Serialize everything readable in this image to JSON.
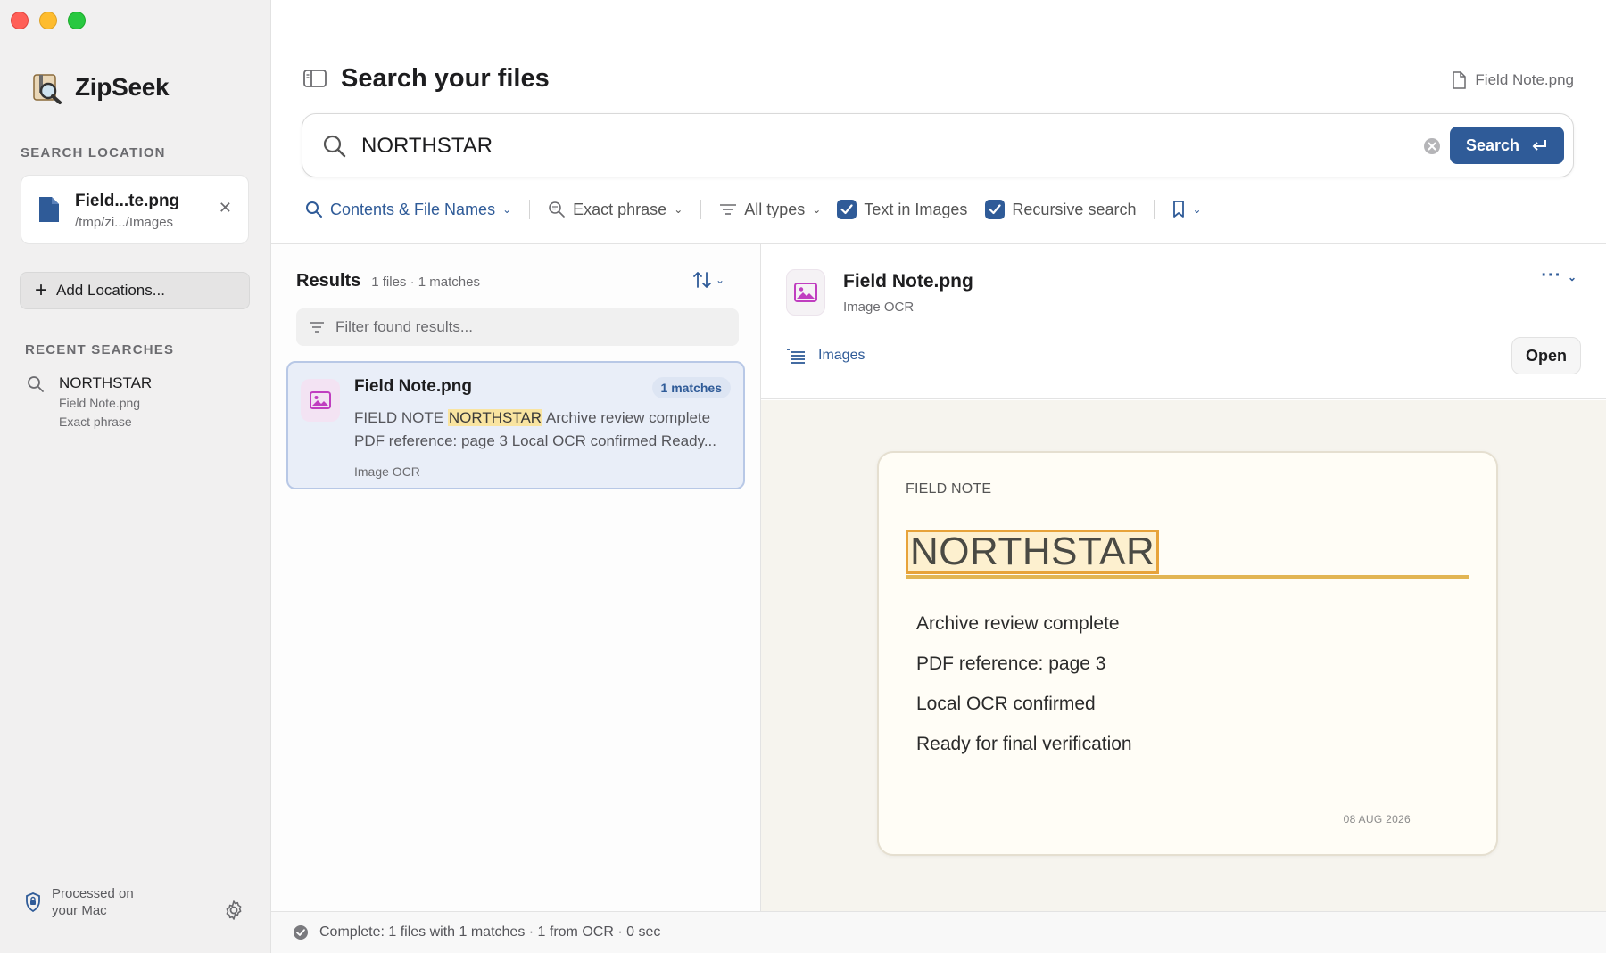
{
  "app": {
    "name": "ZipSeek"
  },
  "sidebar": {
    "search_location_label": "SEARCH LOCATION",
    "location": {
      "name": "Field...te.png",
      "path": "/tmp/zi.../Images"
    },
    "add_locations_label": "Add Locations...",
    "recent_label": "RECENT SEARCHES",
    "recent": [
      {
        "term": "NORTHSTAR",
        "file": "Field Note.png",
        "mode": "Exact phrase"
      }
    ],
    "processed_label": "Processed on your Mac"
  },
  "header": {
    "title": "Search your files",
    "current_file": "Field Note.png"
  },
  "search": {
    "query": "NORTHSTAR",
    "button_label": "Search"
  },
  "filters": {
    "scope": "Contents & File Names",
    "match_mode": "Exact phrase",
    "types": "All types",
    "text_in_images": {
      "label": "Text in Images",
      "checked": true
    },
    "recursive": {
      "label": "Recursive search",
      "checked": true
    }
  },
  "results": {
    "title": "Results",
    "count_text": "1 files · 1 matches",
    "filter_placeholder": "Filter found results...",
    "items": [
      {
        "name": "Field Note.png",
        "badge": "1 matches",
        "line1_before": "FIELD NOTE ",
        "line1_match": "NORTHSTAR",
        "line1_after": " Archive review complete",
        "line2": "PDF reference: page 3 Local OCR confirmed Ready...",
        "type": "Image OCR"
      }
    ]
  },
  "preview": {
    "name": "Field Note.png",
    "type": "Image OCR",
    "folder": "Images",
    "open_label": "Open",
    "document": {
      "label": "FIELD NOTE",
      "title": "NORTHSTAR",
      "lines": [
        "Archive review complete",
        "PDF reference: page 3",
        "Local OCR confirmed",
        "Ready for final verification"
      ],
      "date": "08 AUG 2026"
    }
  },
  "status": {
    "text": "Complete: 1 files with 1 matches · 1 from OCR · 0 sec"
  },
  "colors": {
    "accent": "#2f5b98",
    "highlight": "#f9e4a0",
    "highlight_border": "#e7a33a"
  }
}
